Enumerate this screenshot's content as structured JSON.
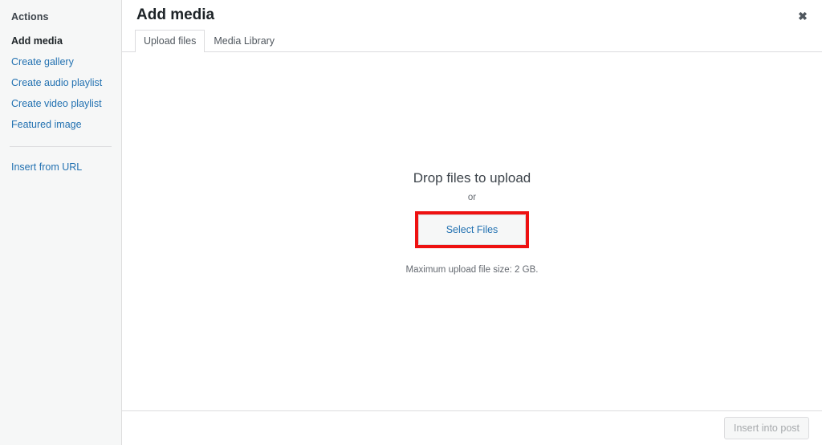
{
  "sidebar": {
    "heading": "Actions",
    "items": [
      {
        "label": "Add media",
        "active": true
      },
      {
        "label": "Create gallery",
        "active": false
      },
      {
        "label": "Create audio playlist",
        "active": false
      },
      {
        "label": "Create video playlist",
        "active": false
      },
      {
        "label": "Featured image",
        "active": false
      }
    ],
    "secondary_items": [
      {
        "label": "Insert from URL",
        "active": false
      }
    ]
  },
  "header": {
    "title": "Add media",
    "close_icon": "close-icon",
    "close_glyph": "✖"
  },
  "tabs": [
    {
      "label": "Upload files",
      "active": true
    },
    {
      "label": "Media Library",
      "active": false
    }
  ],
  "dropzone": {
    "title": "Drop files to upload",
    "or_label": "or",
    "select_files_label": "Select Files",
    "max_upload_text": "Maximum upload file size: 2 GB."
  },
  "footer": {
    "insert_label": "Insert into post",
    "insert_disabled": true
  },
  "colors": {
    "link_blue": "#2271b1",
    "highlight_red": "#ee1111",
    "text_dark": "#1d2327",
    "text_muted": "#646970",
    "border": "#dcdcde",
    "sidebar_bg": "#f6f7f7"
  }
}
